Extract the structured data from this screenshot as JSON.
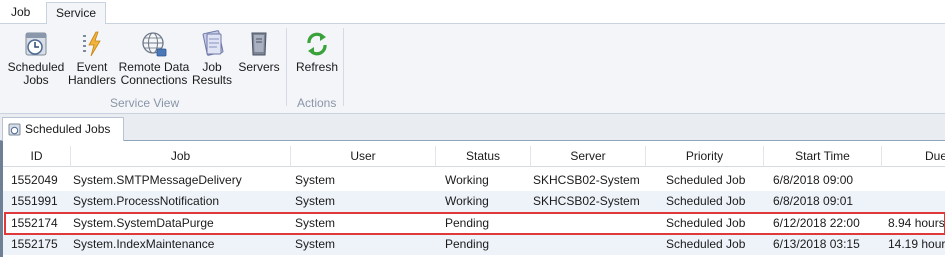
{
  "menu": {
    "tabs": [
      {
        "label": "Job"
      },
      {
        "label": "Service"
      }
    ]
  },
  "ribbon": {
    "groups": [
      {
        "label": "Service View",
        "buttons": [
          {
            "label_line1": "Scheduled",
            "label_line2": "Jobs",
            "icon": "scheduled-jobs-icon"
          },
          {
            "label_line1": "Event",
            "label_line2": "Handlers",
            "icon": "event-handlers-icon"
          },
          {
            "label_line1": "Remote Data",
            "label_line2": "Connections",
            "icon": "remote-data-icon"
          },
          {
            "label_line1": "Job",
            "label_line2": "Results",
            "icon": "job-results-icon"
          },
          {
            "label_line1": "Servers",
            "label_line2": "",
            "icon": "servers-icon"
          }
        ]
      },
      {
        "label": "Actions",
        "buttons": [
          {
            "label_line1": "Refresh",
            "label_line2": "",
            "icon": "refresh-icon"
          }
        ]
      }
    ]
  },
  "document_tab": {
    "label": "Scheduled Jobs"
  },
  "grid": {
    "columns": [
      "ID",
      "Job",
      "User",
      "Status",
      "Server",
      "Priority",
      "Start Time",
      "Due"
    ],
    "rows": [
      {
        "id": "1552049",
        "job": "System.SMTPMessageDelivery",
        "user": "System",
        "status": "Working",
        "server": "SKHCSB02-System",
        "priority": "Scheduled Job",
        "start": "6/8/2018 09:00",
        "due": ""
      },
      {
        "id": "1551991",
        "job": "System.ProcessNotification",
        "user": "System",
        "status": "Working",
        "server": "SKHCSB02-System",
        "priority": "Scheduled Job",
        "start": "6/8/2018 09:01",
        "due": ""
      },
      {
        "id": "1552174",
        "job": "System.SystemDataPurge",
        "user": "System",
        "status": "Pending",
        "server": "",
        "priority": "Scheduled Job",
        "start": "6/12/2018 22:00",
        "due": "8.94 hours"
      },
      {
        "id": "1552175",
        "job": "System.IndexMaintenance",
        "user": "System",
        "status": "Pending",
        "server": "",
        "priority": "Scheduled Job",
        "start": "6/13/2018 03:15",
        "due": "14.19 hours"
      }
    ],
    "selected_row_index": 2
  },
  "colors": {
    "selection_outline": "#e0393b",
    "row_alt": "#eef3fa"
  }
}
